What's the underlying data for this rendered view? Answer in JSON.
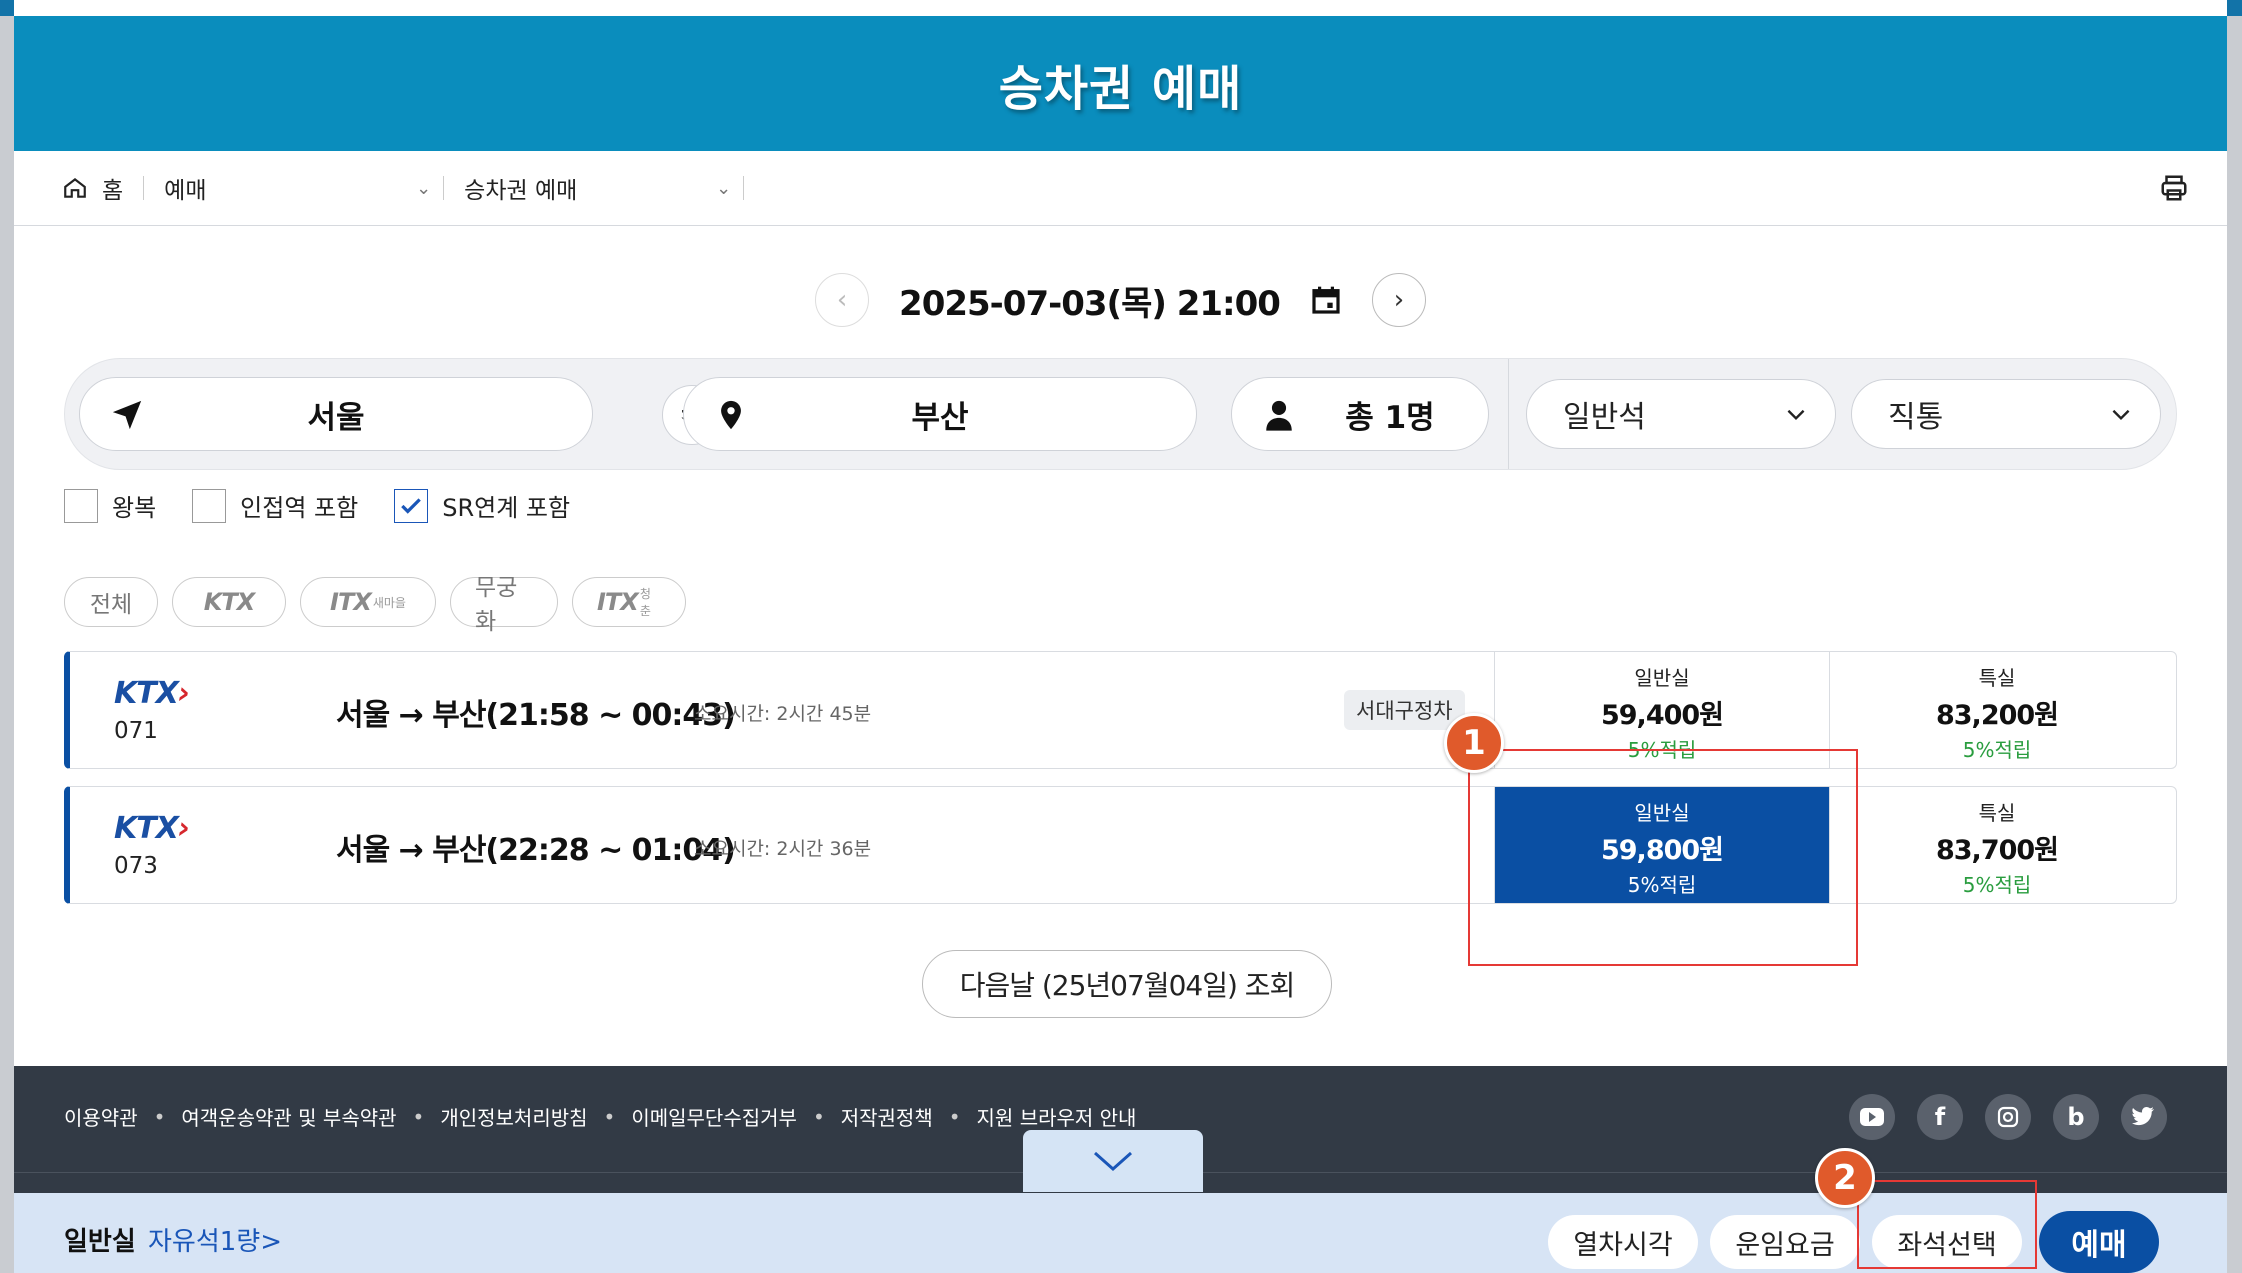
{
  "header": {
    "title": "승차권 예매"
  },
  "breadcrumb": {
    "home": "홈",
    "level1": "예매",
    "level2": "승차권 예매"
  },
  "datebar": {
    "datetime": "2025-07-03(목) 21:00"
  },
  "search": {
    "origin": "서울",
    "destination": "부산",
    "passengers": "총 1명",
    "seat_class": "일반석",
    "route_type": "직통"
  },
  "options": [
    {
      "label": "왕복",
      "checked": false
    },
    {
      "label": "인접역 포함",
      "checked": false
    },
    {
      "label": "SR연계 포함",
      "checked": true
    }
  ],
  "filters": {
    "all": "전체",
    "ktx": "KTX",
    "itx_saemaeul": "ITX",
    "itx_saemaeul_sub": "새마을",
    "mugunghwa": "무궁화",
    "itx_cheongchun": "ITX",
    "itx_cheongchun_sub": "청춘"
  },
  "trains": [
    {
      "brand": "KTX",
      "number": "071",
      "route": "서울 → 부산(21:58 ~ 00:43)",
      "duration": "소요시간: 2시간 45분",
      "badge": "서대구정차",
      "general": {
        "label": "일반실",
        "price": "59,400원",
        "points": "5%적립"
      },
      "special": {
        "label": "특실",
        "price": "83,200원",
        "points": "5%적립"
      }
    },
    {
      "brand": "KTX",
      "number": "073",
      "route": "서울 → 부산(22:28 ~ 01:04)",
      "duration": "소요시간: 2시간 36분",
      "general": {
        "label": "일반실",
        "price": "59,800원",
        "points": "5%적립",
        "selected": true
      },
      "special": {
        "label": "특실",
        "price": "83,700원",
        "points": "5%적립"
      }
    }
  ],
  "next_day": "다음날 (25년07월04일) 조회",
  "annotations": {
    "marker1": "1",
    "marker2": "2"
  },
  "footer": {
    "links": [
      "이용약관",
      "여객운송약관 및 부속약관",
      "개인정보처리방침",
      "이메일무단수집거부",
      "저작권정책",
      "지원 브라우저 안내"
    ],
    "social": [
      "youtube-icon",
      "facebook-icon",
      "instagram-icon",
      "blog-icon",
      "twitter-icon"
    ]
  },
  "bottombar": {
    "class": "일반실",
    "seat_link": "자유석1량>",
    "timetable": "열차시각",
    "fare": "운임요금",
    "seat_select": "좌석선택",
    "book": "예매"
  },
  "colors": {
    "header": "#0a8dbd",
    "accent": "#0a4fa3",
    "points": "#2a9d3f",
    "annotation": "#e53935"
  }
}
